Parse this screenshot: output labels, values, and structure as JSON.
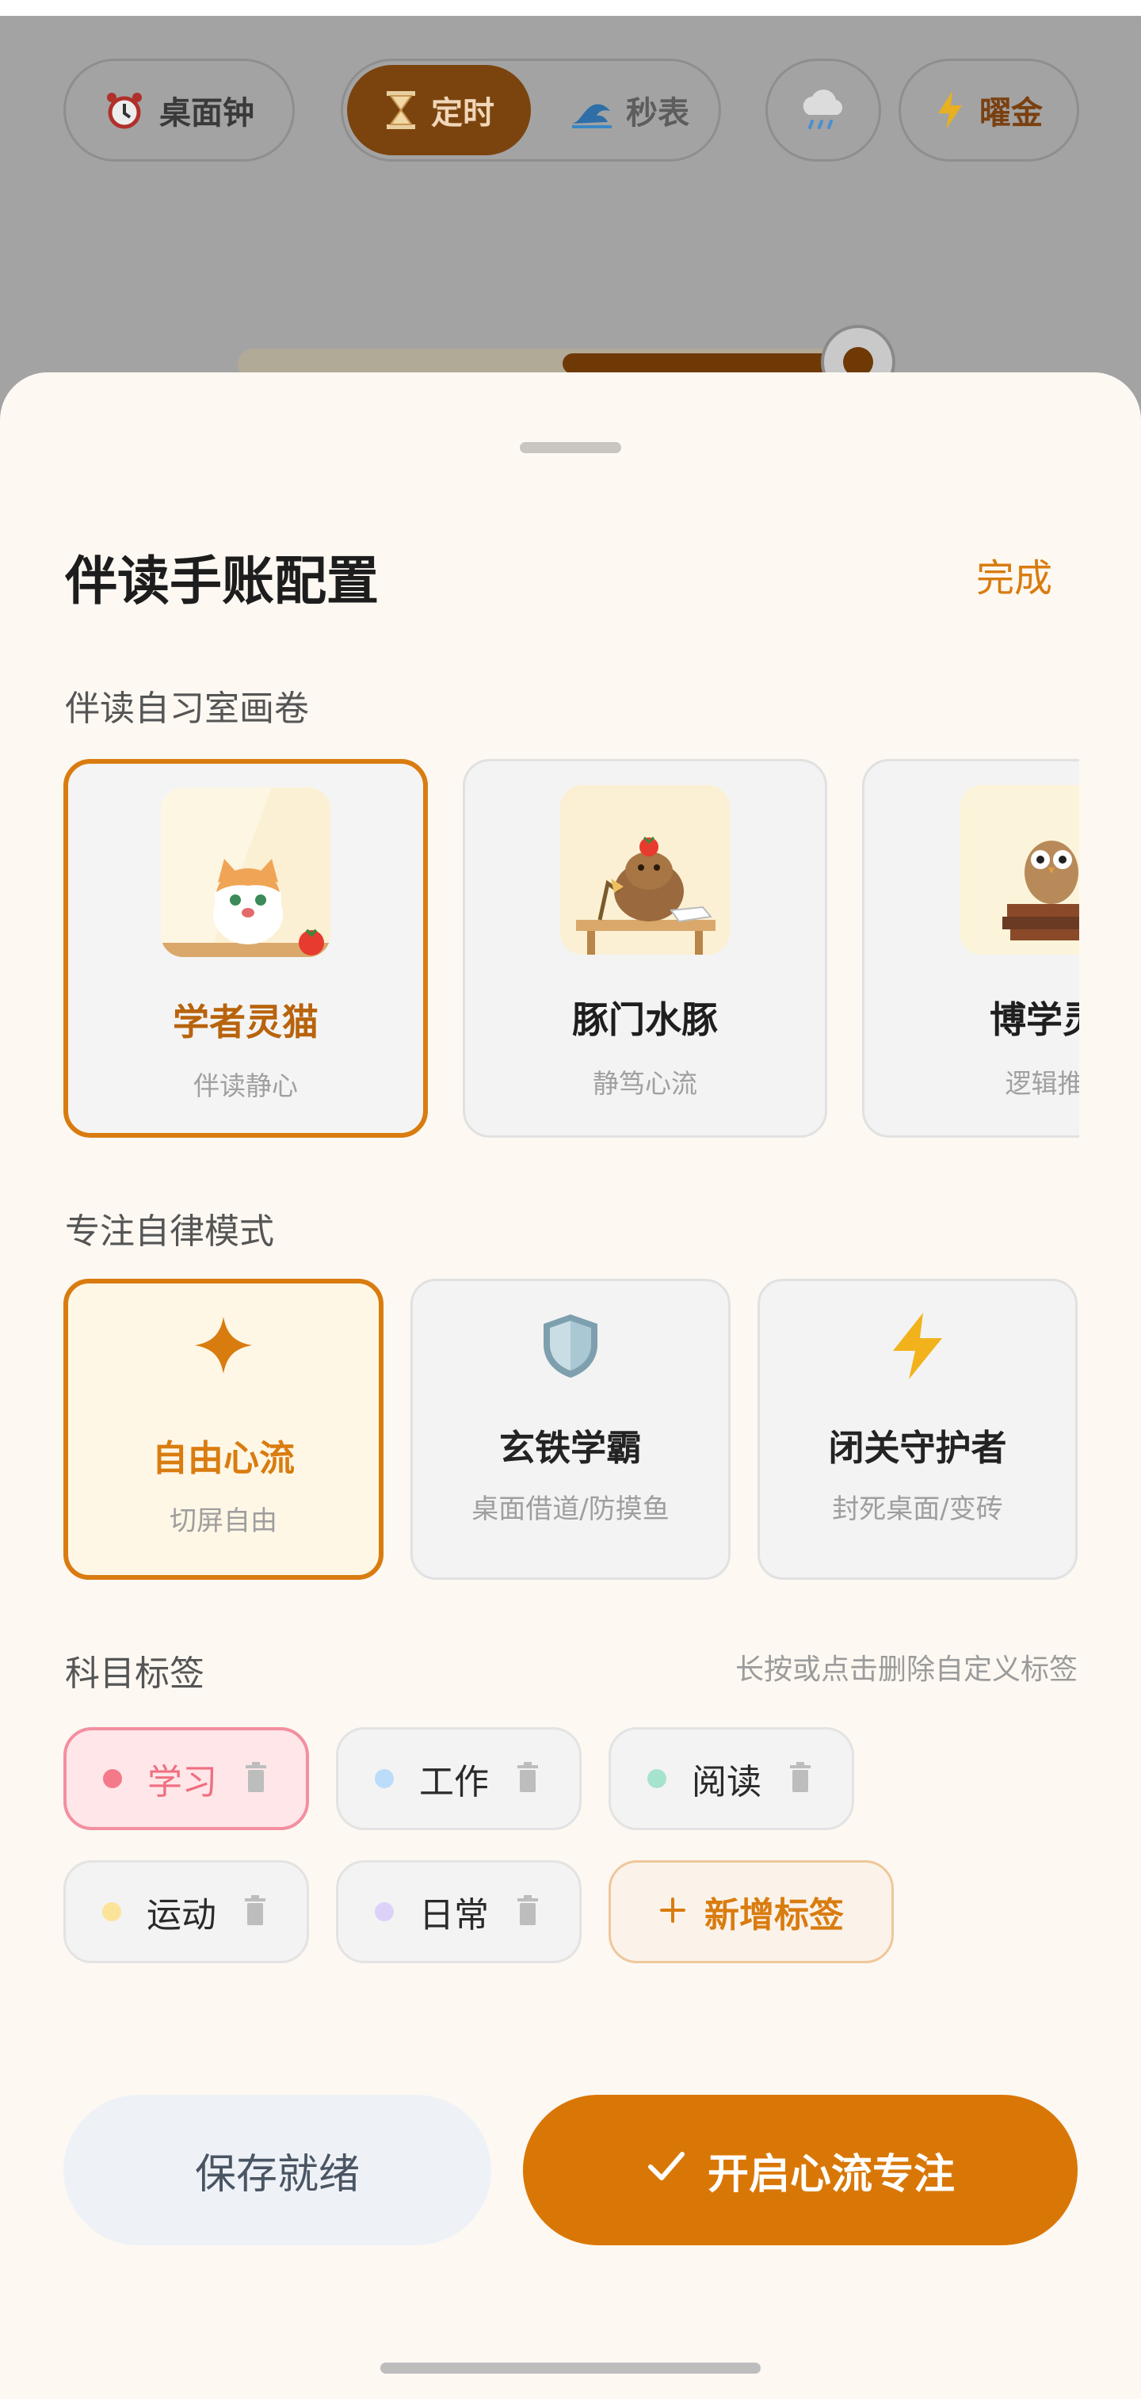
{
  "top_bar": {
    "desk_clock": {
      "label": "桌面钟",
      "icon": "alarm-clock-icon"
    },
    "mode_tabs": [
      {
        "label": "定时",
        "icon": "hourglass-icon",
        "active": true
      },
      {
        "label": "秒表",
        "icon": "wave-icon",
        "active": false
      }
    ],
    "weather": {
      "icon": "rain-cloud-icon"
    },
    "theme": {
      "label": "曜金",
      "icon": "lightning-icon"
    },
    "progress": 0.55
  },
  "sheet": {
    "title": "伴读手账配置",
    "done_label": "完成",
    "scenes_section": "伴读自习室画卷",
    "scenes": [
      {
        "name": "学者灵猫",
        "sub": "伴读静心",
        "icon": "cat-icon",
        "selected": true
      },
      {
        "name": "豚门水豚",
        "sub": "静笃心流",
        "icon": "capybara-icon",
        "selected": false
      },
      {
        "name": "博学灵",
        "sub": "逻辑推",
        "icon": "owl-icon",
        "selected": false
      }
    ],
    "modes_section": "专注自律模式",
    "modes": [
      {
        "name": "自由心流",
        "sub": "切屏自由",
        "icon": "sparkle-icon",
        "selected": true
      },
      {
        "name": "玄铁学霸",
        "sub": "桌面借道/防摸鱼",
        "icon": "shield-icon",
        "selected": false
      },
      {
        "name": "闭关守护者",
        "sub": "封死桌面/变砖",
        "icon": "lightning-icon",
        "selected": false
      }
    ],
    "tags_section": "科目标签",
    "tags_hint": "长按或点击删除自定义标签",
    "tags": [
      {
        "label": "学习",
        "color": "#f47a8a",
        "selected": true
      },
      {
        "label": "工作",
        "color": "#bcdcfb",
        "selected": false
      },
      {
        "label": "阅读",
        "color": "#a6e3cc",
        "selected": false
      },
      {
        "label": "运动",
        "color": "#fbe49a",
        "selected": false
      },
      {
        "label": "日常",
        "color": "#dcd2f7",
        "selected": false
      }
    ],
    "add_tag_label": "新增标签",
    "save_label": "保存就绪",
    "start_label": "开启心流专注",
    "accent": "#d97c10"
  }
}
